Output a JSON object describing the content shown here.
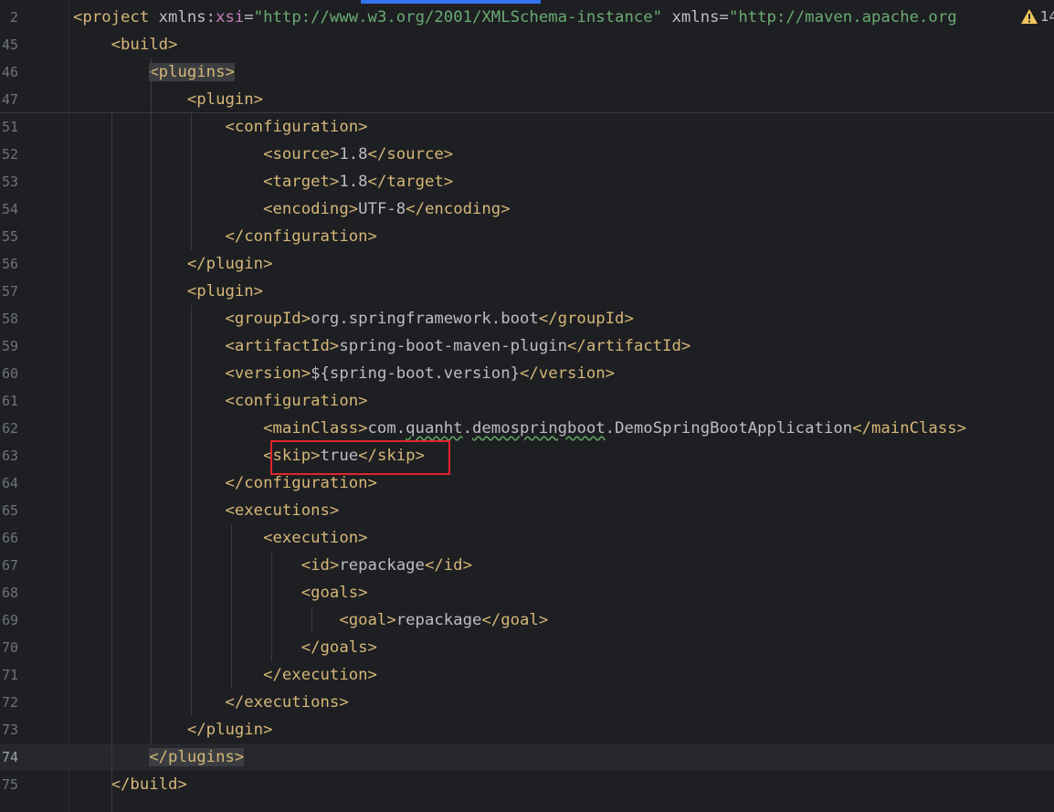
{
  "warning_count": "14",
  "lines": [
    {
      "num": "2",
      "parts": [
        {
          "c": "tag",
          "t": "<project "
        },
        {
          "c": "attr",
          "t": "xmlns:"
        },
        {
          "c": "ns",
          "t": "xsi"
        },
        {
          "c": "attr",
          "t": "="
        },
        {
          "c": "str",
          "t": "\"http://www.w3.org/2001/XMLSchema-instance\""
        },
        {
          "c": "attr",
          "t": " xmlns="
        },
        {
          "c": "str",
          "t": "\"http://maven.apache.org"
        }
      ]
    },
    {
      "num": "45",
      "parts": [
        {
          "c": "tag",
          "t": "    <build>"
        }
      ]
    },
    {
      "num": "46",
      "parts": [
        {
          "c": "tag",
          "t": "        "
        },
        {
          "c": "tag hl",
          "t": "<plugins>"
        }
      ]
    },
    {
      "num": "47",
      "parts": [
        {
          "c": "tag",
          "t": "            <plugin>"
        }
      ]
    },
    {
      "num": "51",
      "parts": [
        {
          "c": "tag",
          "t": "                <configuration>"
        }
      ]
    },
    {
      "num": "52",
      "parts": [
        {
          "c": "tag",
          "t": "                    <source>"
        },
        {
          "c": "txt",
          "t": "1.8"
        },
        {
          "c": "tag",
          "t": "</source>"
        }
      ]
    },
    {
      "num": "53",
      "parts": [
        {
          "c": "tag",
          "t": "                    <target>"
        },
        {
          "c": "txt",
          "t": "1.8"
        },
        {
          "c": "tag",
          "t": "</target>"
        }
      ]
    },
    {
      "num": "54",
      "parts": [
        {
          "c": "tag",
          "t": "                    <encoding>"
        },
        {
          "c": "txt",
          "t": "UTF-8"
        },
        {
          "c": "tag",
          "t": "</encoding>"
        }
      ]
    },
    {
      "num": "55",
      "parts": [
        {
          "c": "tag",
          "t": "                </configuration>"
        }
      ]
    },
    {
      "num": "56",
      "parts": [
        {
          "c": "tag",
          "t": "            </plugin>"
        }
      ]
    },
    {
      "num": "57",
      "parts": [
        {
          "c": "tag",
          "t": "            <plugin>"
        }
      ]
    },
    {
      "num": "58",
      "parts": [
        {
          "c": "tag",
          "t": "                <groupId>"
        },
        {
          "c": "txt",
          "t": "org.springframework.boot"
        },
        {
          "c": "tag",
          "t": "</groupId>"
        }
      ]
    },
    {
      "num": "59",
      "parts": [
        {
          "c": "tag",
          "t": "                <artifactId>"
        },
        {
          "c": "txt",
          "t": "spring-boot-maven-plugin"
        },
        {
          "c": "tag",
          "t": "</artifactId>"
        }
      ]
    },
    {
      "num": "60",
      "parts": [
        {
          "c": "tag",
          "t": "                <version>"
        },
        {
          "c": "txt",
          "t": "${spring-boot.version}"
        },
        {
          "c": "tag",
          "t": "</version>"
        }
      ]
    },
    {
      "num": "61",
      "parts": [
        {
          "c": "tag",
          "t": "                <configuration>"
        }
      ]
    },
    {
      "num": "62",
      "parts": [
        {
          "c": "tag",
          "t": "                    <mainClass>"
        },
        {
          "c": "txt",
          "t": "com."
        },
        {
          "c": "txt squiggle",
          "t": "quanht"
        },
        {
          "c": "txt",
          "t": "."
        },
        {
          "c": "txt squiggle",
          "t": "demospringboot"
        },
        {
          "c": "txt",
          "t": ".DemoSpringBootApplication"
        },
        {
          "c": "tag",
          "t": "</mainClass>"
        }
      ]
    },
    {
      "num": "63",
      "parts": [
        {
          "c": "tag",
          "t": "                    <skip>"
        },
        {
          "c": "txt",
          "t": "true"
        },
        {
          "c": "tag",
          "t": "</skip>"
        }
      ]
    },
    {
      "num": "64",
      "parts": [
        {
          "c": "tag",
          "t": "                </configuration>"
        }
      ]
    },
    {
      "num": "65",
      "parts": [
        {
          "c": "tag",
          "t": "                <executions>"
        }
      ]
    },
    {
      "num": "66",
      "parts": [
        {
          "c": "tag",
          "t": "                    <execution>"
        }
      ]
    },
    {
      "num": "67",
      "parts": [
        {
          "c": "tag",
          "t": "                        <id>"
        },
        {
          "c": "txt",
          "t": "repackage"
        },
        {
          "c": "tag",
          "t": "</id>"
        }
      ]
    },
    {
      "num": "68",
      "parts": [
        {
          "c": "tag",
          "t": "                        <goals>"
        }
      ]
    },
    {
      "num": "69",
      "parts": [
        {
          "c": "tag",
          "t": "                            <goal>"
        },
        {
          "c": "txt",
          "t": "repackage"
        },
        {
          "c": "tag",
          "t": "</goal>"
        }
      ]
    },
    {
      "num": "70",
      "parts": [
        {
          "c": "tag",
          "t": "                        </goals>"
        }
      ]
    },
    {
      "num": "71",
      "parts": [
        {
          "c": "tag",
          "t": "                    </execution>"
        }
      ]
    },
    {
      "num": "72",
      "parts": [
        {
          "c": "tag",
          "t": "                </executions>"
        }
      ]
    },
    {
      "num": "73",
      "parts": [
        {
          "c": "tag",
          "t": "            </plugin>"
        }
      ]
    },
    {
      "num": "74",
      "current": true,
      "parts": [
        {
          "c": "tag",
          "t": "        "
        },
        {
          "c": "tag hl",
          "t": "</plugins>"
        }
      ]
    },
    {
      "num": "75",
      "parts": [
        {
          "c": "tag",
          "t": "    </build>"
        }
      ]
    }
  ]
}
